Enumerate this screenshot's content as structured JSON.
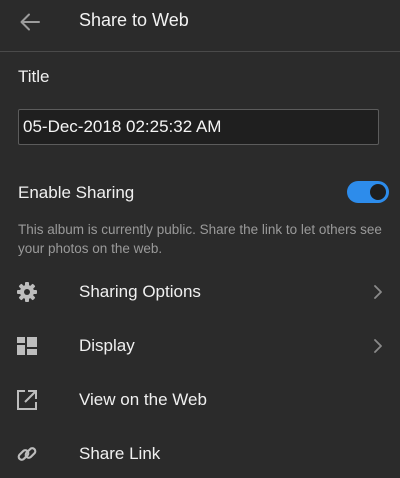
{
  "header": {
    "title": "Share to Web",
    "back_icon": "arrow-left-icon"
  },
  "title_section": {
    "label": "Title",
    "value": "05-Dec-2018 02:25:32 AM"
  },
  "sharing": {
    "label": "Enable Sharing",
    "enabled": true,
    "description": "This album is currently public. Share the link to let others see your photos on the web."
  },
  "menu": {
    "items": [
      {
        "label": "Sharing Options",
        "icon": "gear-icon",
        "has_chevron": true
      },
      {
        "label": "Display",
        "icon": "layout-grid-icon",
        "has_chevron": true
      },
      {
        "label": "View on the Web",
        "icon": "external-link-icon",
        "has_chevron": false
      },
      {
        "label": "Share Link",
        "icon": "link-icon",
        "has_chevron": false
      }
    ]
  },
  "colors": {
    "background": "#2b2b2b",
    "accent": "#2d8ceb",
    "text": "#f0f0f0",
    "muted_text": "#9a9a9a"
  }
}
